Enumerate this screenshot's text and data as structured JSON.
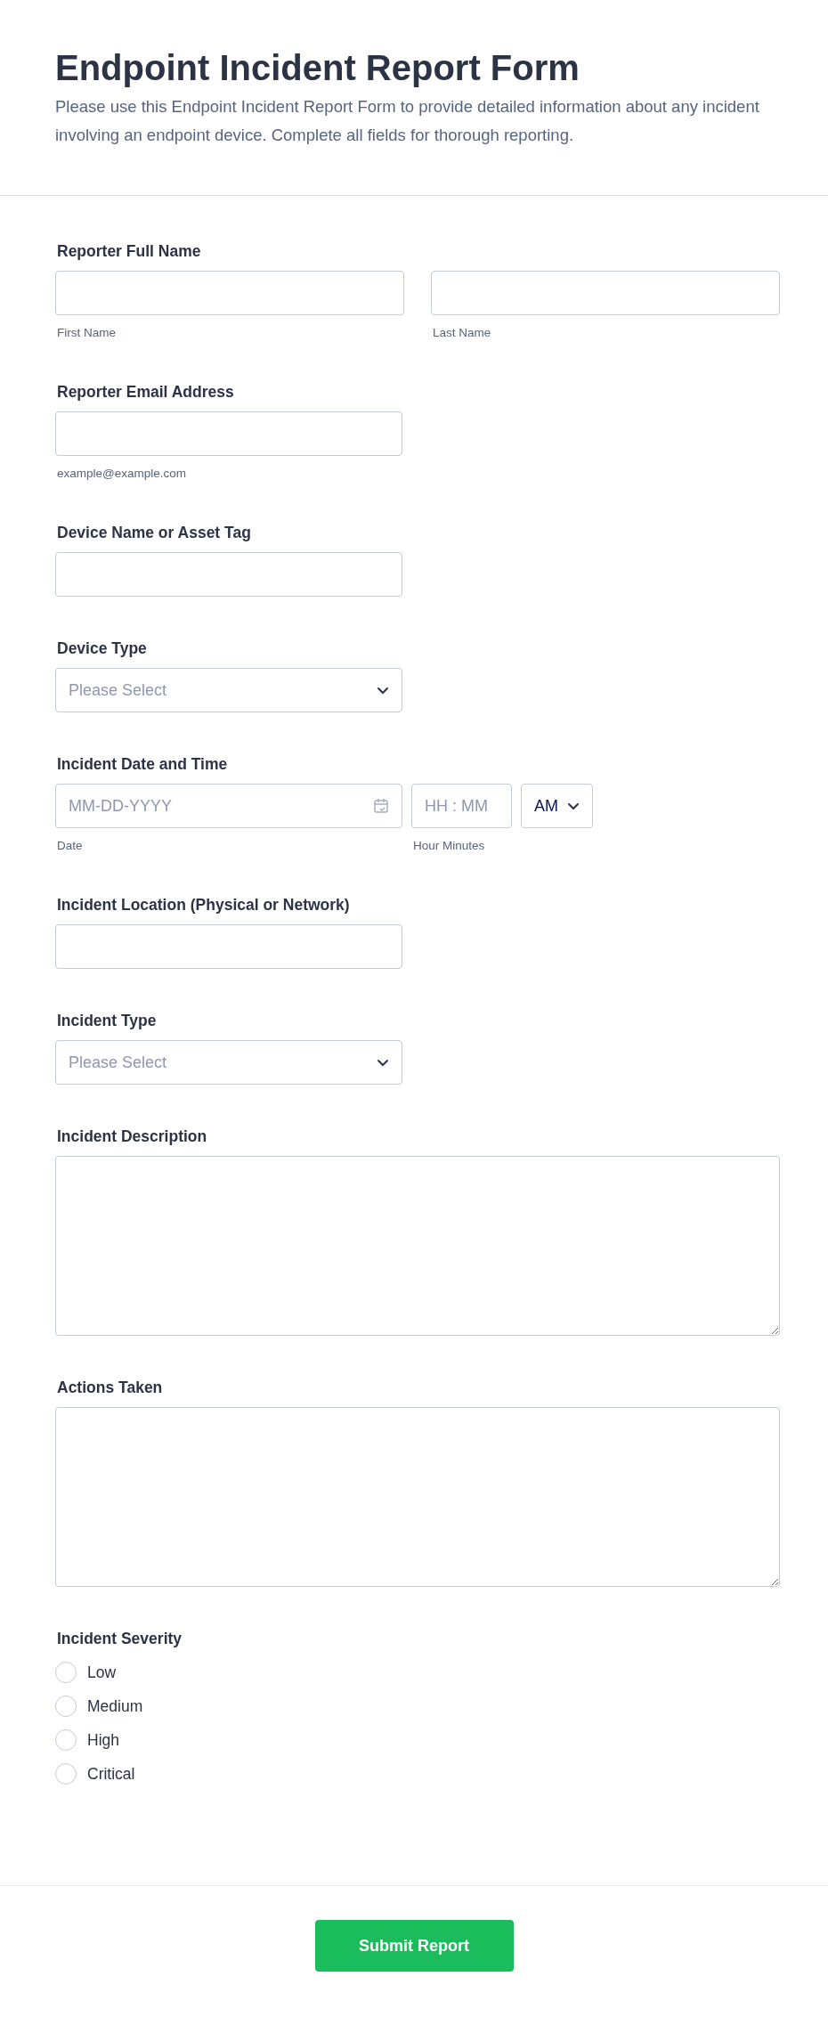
{
  "header": {
    "title": "Endpoint Incident Report Form",
    "description": "Please use this Endpoint Incident Report Form to provide detailed information about any incident involving an endpoint device. Complete all fields for thorough reporting."
  },
  "fields": [
    {
      "kind": "name",
      "label": "Reporter Full Name",
      "sublabels": [
        "First Name",
        "Last Name"
      ]
    },
    {
      "kind": "text",
      "label": "Reporter Email Address",
      "sublabel": "example@example.com"
    },
    {
      "kind": "text",
      "label": "Device Name or Asset Tag"
    },
    {
      "kind": "select",
      "label": "Device Type",
      "placeholder": "Please Select"
    },
    {
      "kind": "datetime",
      "label": "Incident Date and Time",
      "date_placeholder": "MM-DD-YYYY",
      "time_placeholder": "HH : MM",
      "ampm": "AM",
      "date_sublabel": "Date",
      "time_sublabel": "Hour Minutes"
    },
    {
      "kind": "text",
      "label": "Incident Location (Physical or Network)"
    },
    {
      "kind": "select",
      "label": "Incident Type",
      "placeholder": "Please Select"
    },
    {
      "kind": "textarea",
      "label": "Incident Description"
    },
    {
      "kind": "textarea",
      "label": "Actions Taken"
    },
    {
      "kind": "radio",
      "label": "Incident Severity",
      "options": [
        {
          "label": "Low",
          "selected": false
        },
        {
          "label": "Medium",
          "selected": false
        },
        {
          "label": "High",
          "selected": false
        },
        {
          "label": "Critical",
          "selected": false
        }
      ]
    }
  ],
  "submit": "Submit Report"
}
